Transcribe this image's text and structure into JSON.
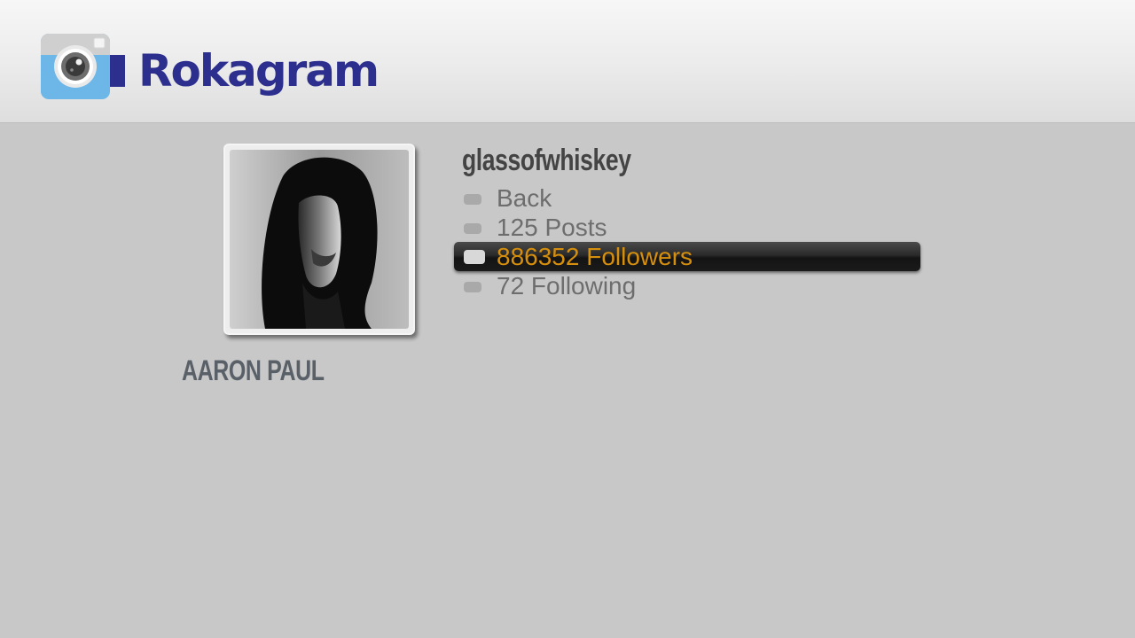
{
  "app": {
    "title": "Rokagram",
    "logo_icon": "camera-icon"
  },
  "profile": {
    "username": "glassofwhiskey",
    "full_name": "AARON PAUL",
    "avatar": "profile-photo"
  },
  "menu": {
    "items": [
      {
        "label": "Back",
        "selected": false
      },
      {
        "label": "125 Posts",
        "selected": false
      },
      {
        "label": "886352 Followers",
        "selected": true
      },
      {
        "label": "72 Following",
        "selected": false
      }
    ]
  },
  "colors": {
    "brand": "#2c2f8e",
    "selected_text": "#d68f0c",
    "background": "#c8c8c8"
  }
}
